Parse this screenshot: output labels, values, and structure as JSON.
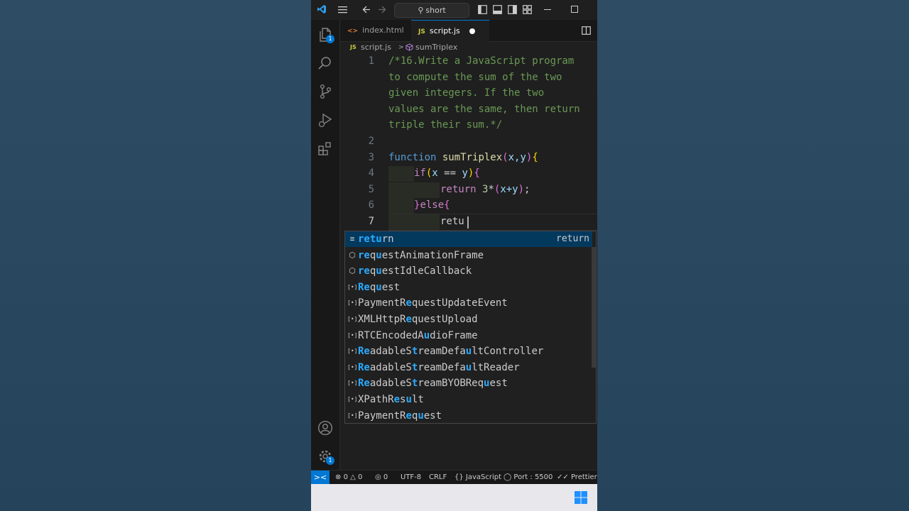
{
  "titlebar": {
    "search_text": "short"
  },
  "tabs": [
    {
      "icon": "<>",
      "label": "index.html"
    },
    {
      "icon": "JS",
      "label": "script.js"
    }
  ],
  "breadcrumb": {
    "file_icon": "JS",
    "file": "script.js",
    "separator": ">",
    "symbol": "sumTriplex"
  },
  "editor": {
    "line_numbers": [
      "1",
      "2",
      "3",
      "4",
      "5",
      "6",
      "7"
    ],
    "comment_lines": [
      "/*16.Write a JavaScript program",
      "to compute the sum of the two",
      "given integers. If the two",
      "values are the same, then return",
      "triple their sum.*/"
    ],
    "line3": {
      "keyword": "function",
      "name": "sumTriplex",
      "open": "(",
      "params": "x,y",
      "close": ")",
      "brace": "{"
    },
    "line4": {
      "keyword": "if",
      "open": "(",
      "cond_a": "x",
      "op": " == ",
      "cond_b": "y",
      "close": ")",
      "brace": "{"
    },
    "line5": {
      "keyword": "return",
      "num": " 3",
      "rest": "*",
      "open": "(",
      "expr": "x+y",
      "close": ")",
      "end": ";"
    },
    "line6": {
      "brace_close": "}",
      "keyword": "else",
      "brace": "{"
    },
    "line7": {
      "typed": "retu"
    }
  },
  "suggestions": [
    {
      "icon": "≡",
      "pre": "",
      "parts": [
        [
          "retu",
          true
        ],
        [
          "rn",
          false
        ]
      ],
      "detail": "return",
      "selected": true
    },
    {
      "icon": "⬡",
      "parts": [
        [
          "re",
          true
        ],
        [
          "q",
          false
        ],
        [
          "u",
          true
        ],
        [
          "estAnimationFrame",
          false
        ]
      ],
      "detail": ""
    },
    {
      "icon": "⬡",
      "parts": [
        [
          "re",
          true
        ],
        [
          "q",
          false
        ],
        [
          "u",
          true
        ],
        [
          "estIdleCallback",
          false
        ]
      ],
      "detail": ""
    },
    {
      "icon": "[•]",
      "parts": [
        [
          "Re",
          true
        ],
        [
          "q",
          false
        ],
        [
          "u",
          true
        ],
        [
          "est",
          false
        ]
      ],
      "detail": ""
    },
    {
      "icon": "[•]",
      "parts": [
        [
          "PaymentR",
          false
        ],
        [
          "e",
          true
        ],
        [
          "questUpdateEvent",
          false
        ]
      ],
      "detail": ""
    },
    {
      "icon": "[•]",
      "parts": [
        [
          "XMLHttpR",
          false
        ],
        [
          "e",
          true
        ],
        [
          "questUpload",
          false
        ]
      ],
      "detail": ""
    },
    {
      "icon": "[•]",
      "parts": [
        [
          "RTCEncodedA",
          false
        ],
        [
          "u",
          true
        ],
        [
          "dioFrame",
          false
        ]
      ],
      "detail": ""
    },
    {
      "icon": "[•]",
      "parts": [
        [
          "Re",
          true
        ],
        [
          "adableS",
          false
        ],
        [
          "t",
          true
        ],
        [
          "reamDefa",
          false
        ],
        [
          "u",
          true
        ],
        [
          "ltController",
          false
        ]
      ],
      "detail": ""
    },
    {
      "icon": "[•]",
      "parts": [
        [
          "Re",
          true
        ],
        [
          "adableS",
          false
        ],
        [
          "t",
          true
        ],
        [
          "reamDefa",
          false
        ],
        [
          "u",
          true
        ],
        [
          "ltReader",
          false
        ]
      ],
      "detail": ""
    },
    {
      "icon": "[•]",
      "parts": [
        [
          "Re",
          true
        ],
        [
          "adableS",
          false
        ],
        [
          "t",
          true
        ],
        [
          "reamBYOBReq",
          false
        ],
        [
          "u",
          true
        ],
        [
          "est",
          false
        ]
      ],
      "detail": ""
    },
    {
      "icon": "[•]",
      "parts": [
        [
          "XPathR",
          false
        ],
        [
          "e",
          true
        ],
        [
          "s",
          false
        ],
        [
          "u",
          true
        ],
        [
          "lt",
          false
        ]
      ],
      "detail": ""
    },
    {
      "icon": "[•]",
      "parts": [
        [
          "PaymentR",
          false
        ],
        [
          "e",
          true
        ],
        [
          "q",
          false
        ],
        [
          "u",
          true
        ],
        [
          "est",
          false
        ]
      ],
      "detail": ""
    }
  ],
  "status": {
    "remote_icon": "><",
    "errors": "0",
    "warnings": "0",
    "ports_icon": "0",
    "encoding": "UTF-8",
    "eol": "CRLF",
    "language": "JavaScript",
    "port": "Port : 5500",
    "formatter": "Prettier"
  },
  "badges": {
    "explorer": "1",
    "settings": "1"
  },
  "colors": {
    "accent": "#0078d4",
    "comment": "#6a9955",
    "keyword": "#569cd6",
    "function": "#dcdcaa",
    "match_highlight": "#2aaaff"
  }
}
